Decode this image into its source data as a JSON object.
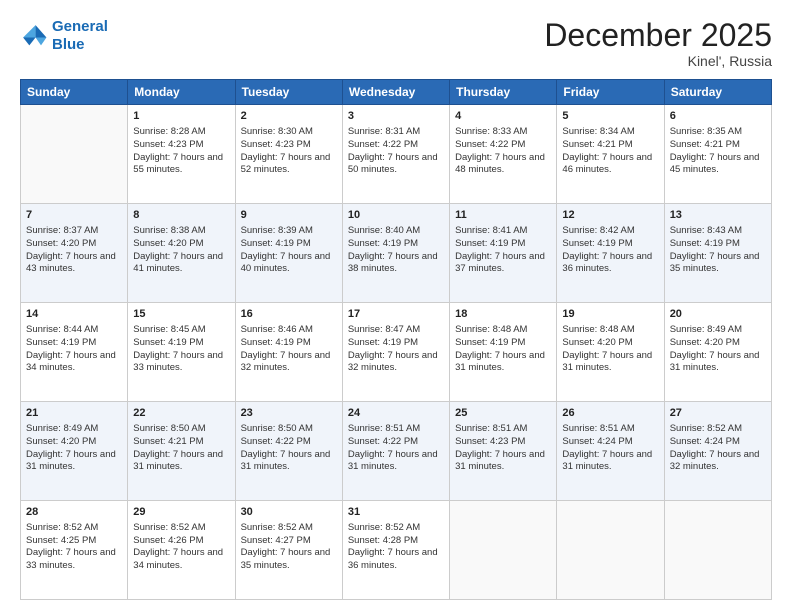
{
  "header": {
    "logo_line1": "General",
    "logo_line2": "Blue",
    "month_title": "December 2025",
    "location": "Kinel', Russia"
  },
  "weekdays": [
    "Sunday",
    "Monday",
    "Tuesday",
    "Wednesday",
    "Thursday",
    "Friday",
    "Saturday"
  ],
  "weeks": [
    [
      {
        "day": null
      },
      {
        "day": "1",
        "sunrise": "8:28 AM",
        "sunset": "4:23 PM",
        "daylight": "7 hours and 55 minutes."
      },
      {
        "day": "2",
        "sunrise": "8:30 AM",
        "sunset": "4:23 PM",
        "daylight": "7 hours and 52 minutes."
      },
      {
        "day": "3",
        "sunrise": "8:31 AM",
        "sunset": "4:22 PM",
        "daylight": "7 hours and 50 minutes."
      },
      {
        "day": "4",
        "sunrise": "8:33 AM",
        "sunset": "4:22 PM",
        "daylight": "7 hours and 48 minutes."
      },
      {
        "day": "5",
        "sunrise": "8:34 AM",
        "sunset": "4:21 PM",
        "daylight": "7 hours and 46 minutes."
      },
      {
        "day": "6",
        "sunrise": "8:35 AM",
        "sunset": "4:21 PM",
        "daylight": "7 hours and 45 minutes."
      }
    ],
    [
      {
        "day": "7",
        "sunrise": "8:37 AM",
        "sunset": "4:20 PM",
        "daylight": "7 hours and 43 minutes."
      },
      {
        "day": "8",
        "sunrise": "8:38 AM",
        "sunset": "4:20 PM",
        "daylight": "7 hours and 41 minutes."
      },
      {
        "day": "9",
        "sunrise": "8:39 AM",
        "sunset": "4:19 PM",
        "daylight": "7 hours and 40 minutes."
      },
      {
        "day": "10",
        "sunrise": "8:40 AM",
        "sunset": "4:19 PM",
        "daylight": "7 hours and 38 minutes."
      },
      {
        "day": "11",
        "sunrise": "8:41 AM",
        "sunset": "4:19 PM",
        "daylight": "7 hours and 37 minutes."
      },
      {
        "day": "12",
        "sunrise": "8:42 AM",
        "sunset": "4:19 PM",
        "daylight": "7 hours and 36 minutes."
      },
      {
        "day": "13",
        "sunrise": "8:43 AM",
        "sunset": "4:19 PM",
        "daylight": "7 hours and 35 minutes."
      }
    ],
    [
      {
        "day": "14",
        "sunrise": "8:44 AM",
        "sunset": "4:19 PM",
        "daylight": "7 hours and 34 minutes."
      },
      {
        "day": "15",
        "sunrise": "8:45 AM",
        "sunset": "4:19 PM",
        "daylight": "7 hours and 33 minutes."
      },
      {
        "day": "16",
        "sunrise": "8:46 AM",
        "sunset": "4:19 PM",
        "daylight": "7 hours and 32 minutes."
      },
      {
        "day": "17",
        "sunrise": "8:47 AM",
        "sunset": "4:19 PM",
        "daylight": "7 hours and 32 minutes."
      },
      {
        "day": "18",
        "sunrise": "8:48 AM",
        "sunset": "4:19 PM",
        "daylight": "7 hours and 31 minutes."
      },
      {
        "day": "19",
        "sunrise": "8:48 AM",
        "sunset": "4:20 PM",
        "daylight": "7 hours and 31 minutes."
      },
      {
        "day": "20",
        "sunrise": "8:49 AM",
        "sunset": "4:20 PM",
        "daylight": "7 hours and 31 minutes."
      }
    ],
    [
      {
        "day": "21",
        "sunrise": "8:49 AM",
        "sunset": "4:20 PM",
        "daylight": "7 hours and 31 minutes."
      },
      {
        "day": "22",
        "sunrise": "8:50 AM",
        "sunset": "4:21 PM",
        "daylight": "7 hours and 31 minutes."
      },
      {
        "day": "23",
        "sunrise": "8:50 AM",
        "sunset": "4:22 PM",
        "daylight": "7 hours and 31 minutes."
      },
      {
        "day": "24",
        "sunrise": "8:51 AM",
        "sunset": "4:22 PM",
        "daylight": "7 hours and 31 minutes."
      },
      {
        "day": "25",
        "sunrise": "8:51 AM",
        "sunset": "4:23 PM",
        "daylight": "7 hours and 31 minutes."
      },
      {
        "day": "26",
        "sunrise": "8:51 AM",
        "sunset": "4:24 PM",
        "daylight": "7 hours and 31 minutes."
      },
      {
        "day": "27",
        "sunrise": "8:52 AM",
        "sunset": "4:24 PM",
        "daylight": "7 hours and 32 minutes."
      }
    ],
    [
      {
        "day": "28",
        "sunrise": "8:52 AM",
        "sunset": "4:25 PM",
        "daylight": "7 hours and 33 minutes."
      },
      {
        "day": "29",
        "sunrise": "8:52 AM",
        "sunset": "4:26 PM",
        "daylight": "7 hours and 34 minutes."
      },
      {
        "day": "30",
        "sunrise": "8:52 AM",
        "sunset": "4:27 PM",
        "daylight": "7 hours and 35 minutes."
      },
      {
        "day": "31",
        "sunrise": "8:52 AM",
        "sunset": "4:28 PM",
        "daylight": "7 hours and 36 minutes."
      },
      {
        "day": null
      },
      {
        "day": null
      },
      {
        "day": null
      }
    ]
  ],
  "labels": {
    "sunrise_prefix": "Sunrise: ",
    "sunset_prefix": "Sunset: ",
    "daylight_prefix": "Daylight: "
  }
}
